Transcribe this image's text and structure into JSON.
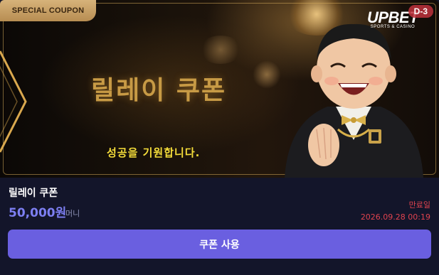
{
  "banner": {
    "badge_label": "SPECIAL COUPON",
    "title": "릴레이 쿠폰",
    "subtitle": "성공을 기원합니다.",
    "brand_logo": "UPBET",
    "brand_sub": "SPORTS & CASINO",
    "d_day": "D-3",
    "accent_color": "#c79a45",
    "subtitle_color": "#f5dd3a",
    "mascot_icon": "laughing-mascot-illustration"
  },
  "coupon": {
    "name": "릴레이 쿠폰",
    "amount": "50,000원",
    "unit": "머니",
    "expiry_label": "만료일",
    "expiry_date": "2026.09.28 00:19",
    "amount_color": "#7d7ff2",
    "expiry_color": "#e0434f"
  },
  "actions": {
    "use_label": "쿠폰 사용",
    "button_color": "#6a5fe0"
  }
}
